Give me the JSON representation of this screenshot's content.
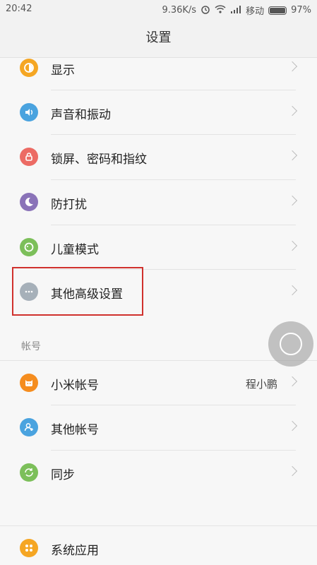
{
  "status": {
    "time": "20:42",
    "speed": "9.36K/s",
    "carrier": "移动",
    "battery": "97%"
  },
  "title": "设置",
  "items": [
    {
      "label": "显示",
      "color": "#f5a623",
      "icon": "display-icon"
    },
    {
      "label": "声音和振动",
      "color": "#4aa3df",
      "icon": "sound-icon"
    },
    {
      "label": "锁屏、密码和指纹",
      "color": "#ec6b64",
      "icon": "lock-icon"
    },
    {
      "label": "防打扰",
      "color": "#8a73b8",
      "icon": "moon-icon"
    },
    {
      "label": "儿童模式",
      "color": "#7cbf5a",
      "icon": "child-icon"
    },
    {
      "label": "其他高级设置",
      "color": "#a6b0b9",
      "icon": "more-icon"
    }
  ],
  "account_section": {
    "header": "帐号",
    "items": [
      {
        "label": "小米帐号",
        "value": "程小鹏",
        "color": "#f58d1f",
        "icon": "mi-account-icon"
      },
      {
        "label": "其他帐号",
        "color": "#4aa3df",
        "icon": "user-icon"
      },
      {
        "label": "同步",
        "color": "#7cbf5a",
        "icon": "sync-icon"
      }
    ]
  },
  "apps": {
    "label": "系统应用",
    "color": "#f5a623",
    "icon": "apps-icon"
  }
}
